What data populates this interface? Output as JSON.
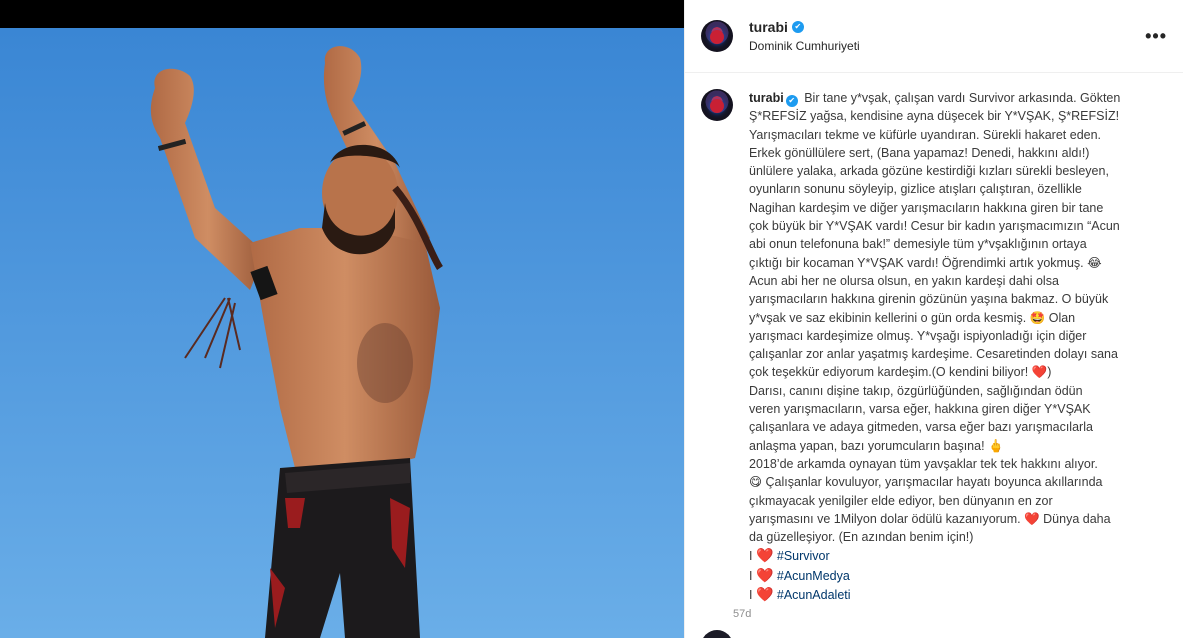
{
  "post": {
    "username": "turabi",
    "location": "Dominik Cumhuriyeti",
    "more_label": "•••",
    "verified_mark": "✔",
    "caption_lines": [
      "Bir tane y*vşak, çalışan vardı Survivor arkasında. Gökten",
      "Ş*REFSİZ yağsa, kendisine ayna düşecek bir Y*VŞAK, Ş*REFSİZ!",
      "Yarışmacıları tekme ve küfürle uyandıran. Sürekli hakaret eden.",
      "Erkek gönüllülere sert, (Bana yapamaz! Denedi, hakkını aldı!)",
      "ünlülere yalaka, arkada gözüne kestirdiği kızları sürekli besleyen,",
      "oyunların sonunu söyleyip, gizlice atışları çalıştıran, özellikle",
      "Nagihan kardeşim ve diğer yarışmacıların hakkına giren bir tane",
      "çok büyük bir Y*VŞAK vardı! Cesur bir kadın yarışmacımızın “Acun",
      "abi onun telefonuna bak!” demesiyle tüm y*vşaklığının ortaya",
      "çıktığı bir kocaman Y*VŞAK vardı! Öğrendimki artık yokmuş. 😂",
      "Acun abi her ne olursa olsun, en yakın kardeşi dahi olsa",
      "yarışmacıların hakkına girenin gözünün yaşına bakmaz. O büyük",
      "y*vşak ve saz ekibinin kellerini o gün orda kesmiş. 🤩 Olan",
      "yarışmacı kardeşimize olmuş. Y*vşağı ispiyonladığı için diğer",
      "çalışanlar zor anlar yaşatmış kardeşime. Cesaretinden dolayı sana",
      "çok teşekkür ediyorum kardeşim.(O kendini biliyor! ❤️)",
      "Darısı, canını dişine takıp, özgürlüğünden, sağlığından ödün",
      "veren yarışmacıların, varsa eğer, hakkına giren diğer Y*VŞAK",
      "çalışanlara ve adaya gitmeden, varsa eğer bazı yarışmacılarla",
      "anlaşma yapan, bazı yorumcuların başına! 🖕",
      "2018’de arkamda oynayan tüm yavşaklar tek tek hakkını alıyor.",
      "😋 Çalışanlar kovuluyor, yarışmacılar hayatı boyunca akıllarında",
      "çıkmayacak yenilgiler elde ediyor, ben dünyanın en zor",
      "yarışmasını ve 1Milyon dolar ödülü kazanıyorum. ❤️ Dünya daha",
      "da güzelleşiyor. (En azından benim için!)"
    ],
    "hashtag_lines": [
      {
        "prefix": "I",
        "heart": "❤️",
        "tag": "#Survivor"
      },
      {
        "prefix": "I",
        "heart": "❤️",
        "tag": "#AcunMedya"
      },
      {
        "prefix": "I",
        "heart": "❤️",
        "tag": "#AcunAdaleti"
      }
    ],
    "timestamp": "57d"
  },
  "colors": {
    "sky": "#3f8fd9",
    "hashtag": "#00376b",
    "verified": "#1d9bf0",
    "heart": "#e0142f"
  }
}
